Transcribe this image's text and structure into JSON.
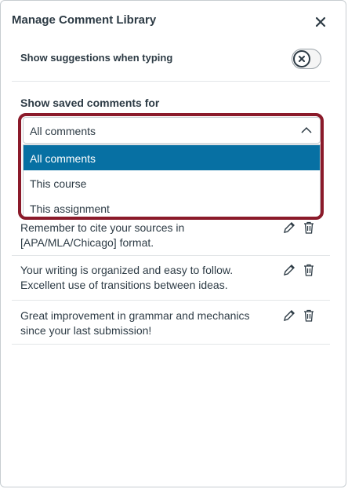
{
  "header": {
    "title": "Manage Comment Library"
  },
  "suggestions": {
    "label": "Show suggestions when typing",
    "enabled": false
  },
  "filter": {
    "label": "Show saved comments for",
    "selected": "All comments",
    "options": [
      "All comments",
      "This course",
      "This assignment"
    ]
  },
  "comments": [
    {
      "text": "Remember to cite your sources in [APA/MLA/Chicago] format."
    },
    {
      "text": "Your writing is organized and easy to follow. Excellent use of transitions between ideas."
    },
    {
      "text": "Great improvement in grammar and mechanics since your last submission!"
    }
  ],
  "colors": {
    "accent": "#0770a3",
    "highlight": "#8b1a2a",
    "text": "#2d3b45"
  },
  "icons": {
    "close": "close-icon",
    "toggle": "x-icon",
    "edit": "pencil-icon",
    "delete": "trash-icon",
    "dropdown": "chevron-up-icon"
  }
}
